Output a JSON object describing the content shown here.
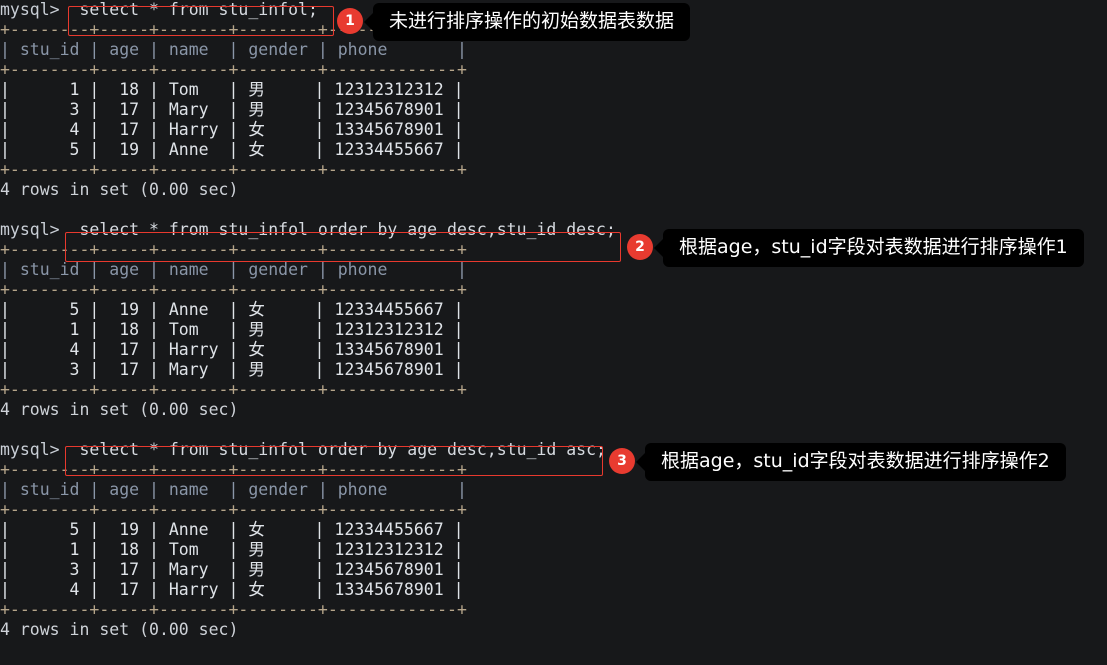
{
  "terminal": {
    "prompt": "mysql>",
    "status_line": "4 rows in set (0.00 sec)",
    "columns": [
      "stu_id",
      "age",
      "name",
      "gender",
      "phone"
    ],
    "rule_top": "+--------+-----+-------+--------+-------------+",
    "rule_mid": "+--------+-----+-------+--------+-------------+",
    "rule_bot": "+--------+-----+-------+--------+-------------+"
  },
  "blocks": [
    {
      "id": "block-1",
      "command": "select * from stu_infol;",
      "badge": "1",
      "callout": "未进行排序操作的初始数据表数据",
      "rows": [
        {
          "stu_id": "1",
          "age": "18",
          "name": "Tom",
          "gender": "男",
          "phone": "12312312312"
        },
        {
          "stu_id": "3",
          "age": "17",
          "name": "Mary",
          "gender": "男",
          "phone": "12345678901"
        },
        {
          "stu_id": "4",
          "age": "17",
          "name": "Harry",
          "gender": "女",
          "phone": "13345678901"
        },
        {
          "stu_id": "5",
          "age": "19",
          "name": "Anne",
          "gender": "女",
          "phone": "12334455667"
        }
      ],
      "status": "4 rows in set (0.00 sec)"
    },
    {
      "id": "block-2",
      "command": "select * from stu_infol order by age desc,stu_id desc;",
      "badge": "2",
      "callout": "根据age，stu_id字段对表数据进行排序操作1",
      "rows": [
        {
          "stu_id": "5",
          "age": "19",
          "name": "Anne",
          "gender": "女",
          "phone": "12334455667"
        },
        {
          "stu_id": "1",
          "age": "18",
          "name": "Tom",
          "gender": "男",
          "phone": "12312312312"
        },
        {
          "stu_id": "4",
          "age": "17",
          "name": "Harry",
          "gender": "女",
          "phone": "13345678901"
        },
        {
          "stu_id": "3",
          "age": "17",
          "name": "Mary",
          "gender": "男",
          "phone": "12345678901"
        }
      ],
      "status": "4 rows in set (0.00 sec)"
    },
    {
      "id": "block-3",
      "command": "select * from stu_infol order by age desc,stu_id asc;",
      "badge": "3",
      "callout": "根据age，stu_id字段对表数据进行排序操作2",
      "rows": [
        {
          "stu_id": "5",
          "age": "19",
          "name": "Anne",
          "gender": "女",
          "phone": "12334455667"
        },
        {
          "stu_id": "1",
          "age": "18",
          "name": "Tom",
          "gender": "男",
          "phone": "12312312312"
        },
        {
          "stu_id": "3",
          "age": "17",
          "name": "Mary",
          "gender": "男",
          "phone": "12345678901"
        },
        {
          "stu_id": "4",
          "age": "17",
          "name": "Harry",
          "gender": "女",
          "phone": "13345678901"
        }
      ],
      "status": "4 rows in set (0.00 sec)"
    }
  ],
  "colors": {
    "background": "#17181a",
    "accent_red": "#e83b30",
    "text": "#c8cdd4",
    "callout_bg": "#000000"
  }
}
